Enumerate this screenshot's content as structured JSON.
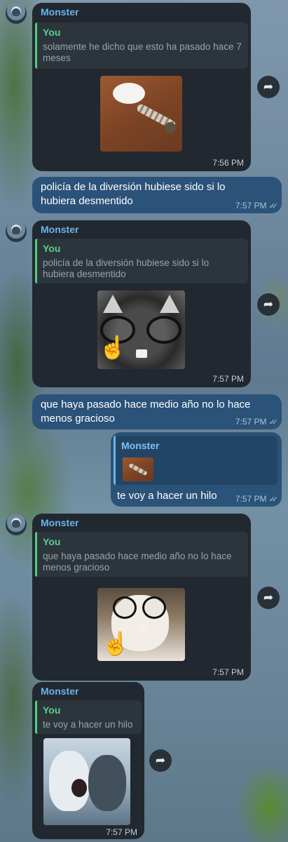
{
  "messages": [
    {
      "sender": "Monster",
      "quote_name": "You",
      "quote_text": "solamente he dicho que esto ha pasado hace 7 meses",
      "media": "sticker-screw",
      "time": "7:56 PM"
    },
    {
      "text": "policía de la diversión hubiese sido si lo hubiera desmentido",
      "time": "7:57 PM",
      "status": "read-double-check"
    },
    {
      "sender": "Monster",
      "quote_name": "You",
      "quote_text": "policía de la diversión hubiese sido si lo hubiera desmentido",
      "media": "sticker-cat-glasses-finger",
      "time": "7:57 PM"
    },
    {
      "text": "que haya pasado hace medio año no lo hace menos gracioso",
      "time": "7:57 PM",
      "status": "read-double-check"
    },
    {
      "quote_name": "Monster",
      "quote_media": "sticker-screw-thumb",
      "text": "te voy a hacer un hilo",
      "time": "7:57 PM",
      "status": "read-double-check"
    },
    {
      "sender": "Monster",
      "quote_name": "You",
      "quote_text": "que haya pasado hace medio año no lo hace menos gracioso",
      "media": "sticker-cat-glasses-finger-2",
      "time": "7:57 PM"
    },
    {
      "sender": "Monster",
      "quote_name": "You",
      "quote_text": "te voy a hacer un hilo",
      "media": "sticker-monkeys",
      "time": "7:57 PM"
    }
  ],
  "icons": {
    "forward": "forward-arrow-icon",
    "read": "double-check-icon",
    "finger": "index-pointing-up-emoji"
  },
  "colors": {
    "incoming_bubble": "#212830",
    "outgoing_bubble": "#2b5278",
    "sender_name": "#6cb4e8",
    "quote_you": "#58d388"
  }
}
